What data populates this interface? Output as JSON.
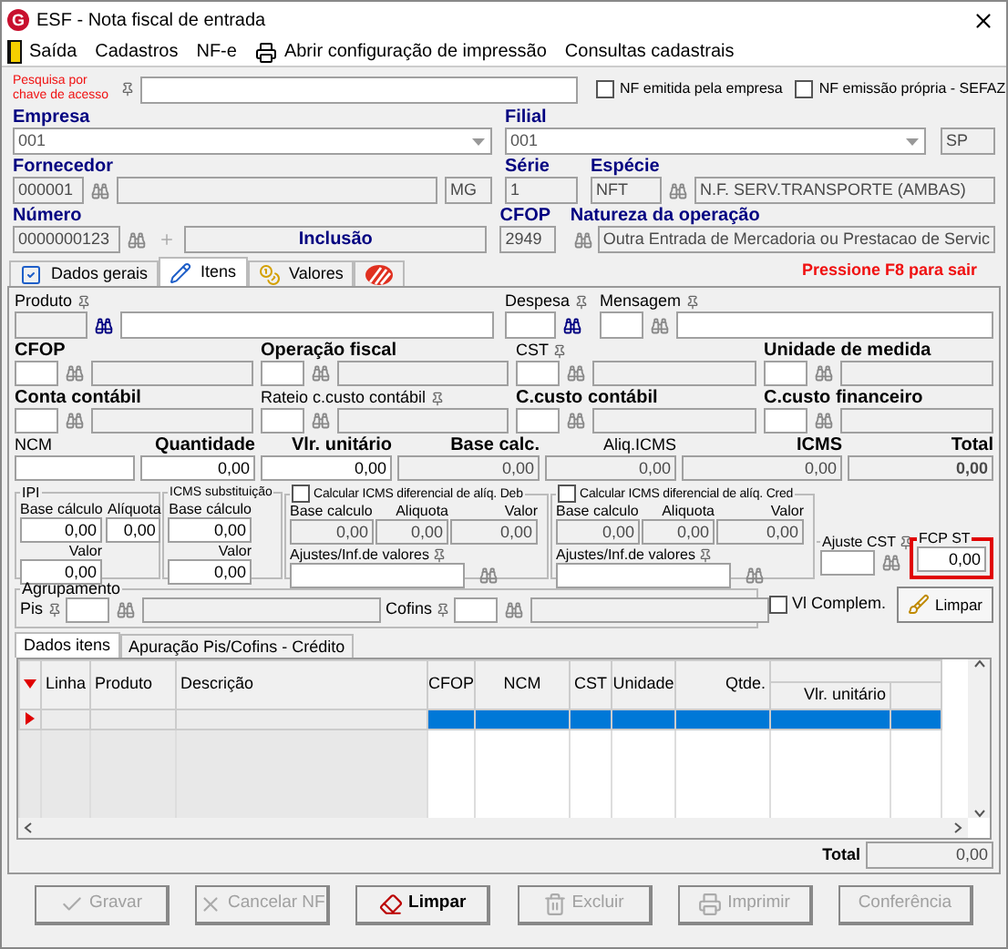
{
  "window": {
    "logo": "G",
    "title": "ESF - Nota fiscal de entrada"
  },
  "menu": [
    {
      "label": "Saída",
      "kind": "exit"
    },
    {
      "label": "Cadastros",
      "kind": "plain"
    },
    {
      "label": "NF-e",
      "kind": "plain"
    },
    {
      "label": "Abrir configuração de impressão",
      "kind": "printer"
    },
    {
      "label": "Consultas cadastrais",
      "kind": "plain"
    }
  ],
  "header": {
    "search": {
      "label": "Pesquisa por chave de acesso"
    },
    "checkboxes": [
      {
        "label": "NF emitida pela empresa",
        "checked": false
      },
      {
        "label": "NF emissão própria - SEFAZ",
        "checked": false
      }
    ],
    "empresa": {
      "label": "Empresa",
      "value": "001"
    },
    "filial": {
      "label": "Filial",
      "value": "001",
      "uf": "SP"
    },
    "fornecedor": {
      "label": "Fornecedor",
      "code": "000001",
      "uf": "MG"
    },
    "serie": {
      "label": "Série",
      "value": "1"
    },
    "especie": {
      "label": "Espécie",
      "code": "NFT",
      "description": "N.F. SERV.TRANSPORTE (AMBAS)"
    },
    "numero": {
      "label": "Número",
      "value": "0000000123",
      "status": "Inclusão"
    },
    "cfop": {
      "label": "CFOP",
      "value": "2949"
    },
    "natureza": {
      "label": "Natureza da operação",
      "value": "Outra Entrada de Mercadoria ou Prestacao de Servic"
    }
  },
  "tabs": [
    {
      "label": "Dados gerais",
      "kind": "check",
      "selected": false
    },
    {
      "label": "Itens",
      "kind": "pencil",
      "selected": true
    },
    {
      "label": "Valores",
      "kind": "coins",
      "selected": false
    },
    {
      "kind": "stripes",
      "selected": false
    }
  ],
  "hint": "Pressione F8 para sair",
  "items": {
    "row1": [
      {
        "label": "Produto",
        "bold": false,
        "pin": true
      },
      {
        "label": "Despesa",
        "bold": false,
        "pin": true
      },
      {
        "label": "Mensagem",
        "bold": false,
        "pin": true
      }
    ],
    "row2": [
      {
        "label": "CFOP",
        "bold": true,
        "pin": false
      },
      {
        "label": "Operação fiscal",
        "bold": true,
        "pin": false
      },
      {
        "label": "CST",
        "bold": false,
        "pin": true
      },
      {
        "label": "Unidade de medida",
        "bold": true,
        "pin": false
      }
    ],
    "row3": [
      {
        "label": "Conta contábil",
        "bold": true,
        "pin": false
      },
      {
        "label": "Rateio c.custo contábil",
        "bold": false,
        "pin": true
      },
      {
        "label": "C.custo contábil",
        "bold": true,
        "pin": false
      },
      {
        "label": "C.custo financeiro",
        "bold": true,
        "pin": false
      }
    ],
    "values": [
      {
        "label": "NCM",
        "bold": false,
        "readonly": false
      },
      {
        "label": "Quantidade",
        "bold": true,
        "value": "0,00",
        "readonly": false
      },
      {
        "label": "Vlr. unitário",
        "bold": true,
        "value": "0,00",
        "readonly": false
      },
      {
        "label": "Base calc.",
        "bold": true,
        "value": "0,00",
        "readonly": true
      },
      {
        "label": "Aliq.ICMS",
        "bold": false,
        "value": "0,00",
        "readonly": true
      },
      {
        "label": "ICMS",
        "bold": true,
        "value": "0,00",
        "readonly": true
      },
      {
        "label": "Total",
        "bold": true,
        "value": "0,00",
        "readonly": true
      }
    ],
    "ipi": {
      "title": "IPI",
      "fields": [
        {
          "label": "Base cálculo",
          "value": "0,00"
        },
        {
          "label": "Alíquota",
          "value": "0,00"
        },
        {
          "label": "Valor",
          "value": "0,00"
        }
      ]
    },
    "icms_st": {
      "title": "ICMS substituição",
      "fields": [
        {
          "label": "Base cálculo",
          "value": "0,00"
        },
        {
          "label": "Valor",
          "value": "0,00"
        }
      ]
    },
    "difal": [
      {
        "label": "Calcular ICMS diferencial de alíq. Deb",
        "checked": false,
        "fields": [
          {
            "label": "Base calculo",
            "value": "0,00"
          },
          {
            "label": "Aliquota",
            "value": "0,00"
          },
          {
            "label": "Valor",
            "value": "0,00"
          }
        ],
        "adjust_label": "Ajustes/Inf.de valores"
      },
      {
        "label": "Calcular ICMS diferencial de alíq. Cred",
        "checked": false,
        "fields": [
          {
            "label": "Base calculo",
            "value": "0,00"
          },
          {
            "label": "Aliquota",
            "value": "0,00"
          },
          {
            "label": "Valor",
            "value": "0,00"
          }
        ],
        "adjust_label": "Ajustes/Inf.de valores"
      }
    ],
    "ajuste_cst": {
      "label": "Ajuste CST"
    },
    "fcp_st": {
      "label": "FCP ST",
      "value": "0,00",
      "highlighted": true
    },
    "agrupamento": {
      "title": "Agrupamento",
      "fields": [
        {
          "label": "Pis"
        },
        {
          "label": "Cofins"
        }
      ]
    },
    "vl_complem": {
      "label": "Vl Complem.",
      "checked": false
    },
    "clear_button": {
      "label": "Limpar"
    },
    "subtabs": [
      {
        "label": "Dados itens",
        "selected": true
      },
      {
        "label": "Apuração Pis/Cofins - Crédito",
        "selected": false
      }
    ],
    "grid": {
      "columns": [
        "Linha",
        "Produto",
        "Descrição",
        "CFOP",
        "NCM",
        "CST",
        "Unidade",
        "Qtde.",
        "Vlr. unitário"
      ],
      "rows": [
        {
          "selected": true
        }
      ]
    },
    "total": {
      "label": "Total",
      "value": "0,00"
    }
  },
  "buttons": [
    {
      "label": "Gravar",
      "kind": "check",
      "disabled": true
    },
    {
      "label": "Cancelar NF",
      "kind": "cross",
      "disabled": true
    },
    {
      "label": "Limpar",
      "kind": "eraser",
      "disabled": false
    },
    {
      "label": "Excluir",
      "kind": "trash",
      "disabled": true
    },
    {
      "label": "Imprimir",
      "kind": "printer",
      "disabled": true
    },
    {
      "label": "Conferência",
      "kind": "none",
      "disabled": true
    }
  ]
}
